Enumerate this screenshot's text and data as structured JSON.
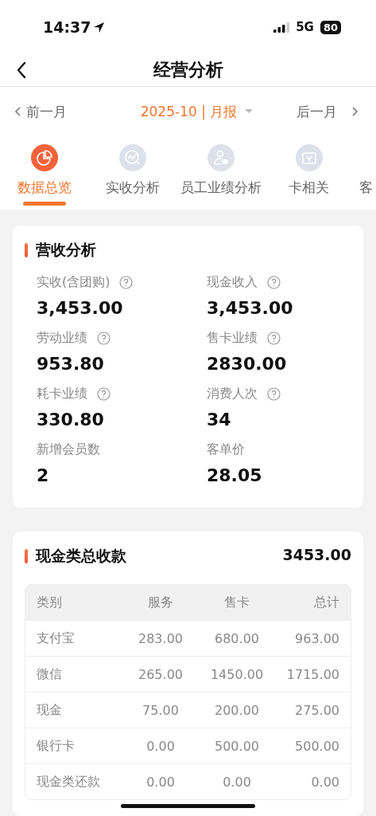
{
  "status_bar": {
    "time": "14:37",
    "network": "5G",
    "battery": "80"
  },
  "nav": {
    "title": "经营分析"
  },
  "period": {
    "prev": "前一月",
    "current": "2025-10 | 月报",
    "next": "后一月"
  },
  "tabs": [
    {
      "label": "数据总览",
      "kind": "pie",
      "selected": true
    },
    {
      "label": "实收分析",
      "kind": "trend",
      "selected": false
    },
    {
      "label": "员工业绩分析",
      "kind": "person",
      "selected": false
    },
    {
      "label": "卡相关",
      "kind": "card",
      "selected": false
    },
    {
      "label": "客",
      "kind": "cut",
      "selected": false
    }
  ],
  "revenue": {
    "title": "营收分析",
    "metrics": [
      {
        "label": "实收(含团购)",
        "value": "3,453.00",
        "help": true
      },
      {
        "label": "现金收入",
        "value": "3,453.00",
        "help": true
      },
      {
        "label": "劳动业绩",
        "value": "953.80",
        "help": true
      },
      {
        "label": "售卡业绩",
        "value": "2830.00",
        "help": true
      },
      {
        "label": "耗卡业绩",
        "value": "330.80",
        "help": true
      },
      {
        "label": "消费人次",
        "value": "34",
        "help": true
      },
      {
        "label": "新增会员数",
        "value": "2",
        "help": false
      },
      {
        "label": "客单价",
        "value": "28.05",
        "help": false
      }
    ]
  },
  "cash": {
    "title": "现金类总收款",
    "total": "3453.00",
    "table": {
      "columns": [
        "类别",
        "服务",
        "售卡",
        "总计"
      ],
      "rows": [
        [
          "支付宝",
          "283.00",
          "680.00",
          "963.00"
        ],
        [
          "微信",
          "265.00",
          "1450.00",
          "1715.00"
        ],
        [
          "现金",
          "75.00",
          "200.00",
          "275.00"
        ],
        [
          "银行卡",
          "0.00",
          "500.00",
          "500.00"
        ],
        [
          "现金类还款",
          "0.00",
          "0.00",
          "0.00"
        ]
      ]
    }
  }
}
